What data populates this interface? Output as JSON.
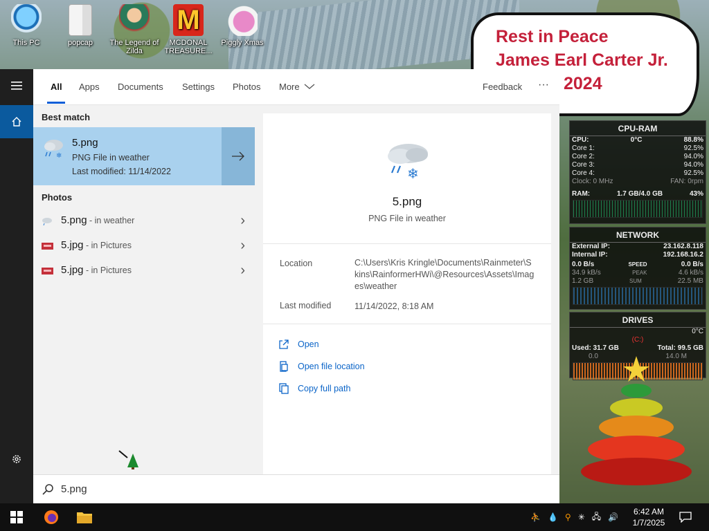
{
  "desktop": {
    "icons": [
      {
        "label": "This PC",
        "icon": "this-pc-icon"
      },
      {
        "label": "popcap",
        "icon": "popcap-icon"
      },
      {
        "label": "The Legend of Zilda",
        "icon": "zilda-game-icon"
      },
      {
        "label": "MCDONAL TREASURE...",
        "icon": "mcdonalds-icon"
      },
      {
        "label": "Piggly Xmas",
        "icon": "piggly-icon"
      }
    ],
    "rip_sign": {
      "line1": "Rest in Peace",
      "line2": "James Earl Carter Jr.",
      "line3": "2024"
    }
  },
  "widgets": {
    "cpu_ram": {
      "title": "CPU-RAM",
      "cpu_label": "CPU:",
      "cpu_temp": "0°C",
      "cpu_pct": "88.8%",
      "cores": [
        {
          "label": "Core 1:",
          "value": "92.5%"
        },
        {
          "label": "Core 2:",
          "value": "94.0%"
        },
        {
          "label": "Core 3:",
          "value": "94.0%"
        },
        {
          "label": "Core 4:",
          "value": "92.5%"
        }
      ],
      "clock": "Clock: 0 MHz",
      "fan": "FAN: 0rpm",
      "ram_label": "RAM:",
      "ram_value": "1.7 GB/4.0 GB",
      "ram_pct": "43%"
    },
    "network": {
      "title": "NETWORK",
      "ext_label": "External IP:",
      "ext_value": "23.162.8.118",
      "int_label": "Internal IP:",
      "int_value": "192.168.16.2",
      "rows": [
        {
          "l": "0.0 B/s",
          "m": "SPEED",
          "r": "0.0 B/s"
        },
        {
          "l": "34.9 kB/s",
          "m": "PEAK",
          "r": "4.6 kB/s"
        },
        {
          "l": "1.2 GB",
          "m": "SUM",
          "r": "22.5 MB"
        }
      ]
    },
    "drives": {
      "title": "DRIVES",
      "temp": "0°C",
      "drive": "(C:)",
      "used": "Used: 31.7 GB",
      "total": "Total: 99.5 GB",
      "read": "0.0",
      "write": "14.0 M"
    }
  },
  "search": {
    "tabs": [
      "All",
      "Apps",
      "Documents",
      "Settings",
      "Photos",
      "More"
    ],
    "feedback": "Feedback",
    "more_dots": "···",
    "best_match_header": "Best match",
    "best_match": {
      "name": "5.png",
      "type": "PNG File in weather",
      "modified": "Last modified: 11/14/2022"
    },
    "photos_header": "Photos",
    "photos": [
      {
        "name": "5.png",
        "loc": " - in weather"
      },
      {
        "name": "5.jpg",
        "loc": " - in Pictures"
      },
      {
        "name": "5.jpg",
        "loc": " - in Pictures"
      }
    ],
    "preview": {
      "title": "5.png",
      "subtitle": "PNG File in weather",
      "location_label": "Location",
      "location_value": "C:\\Users\\Kris Kringle\\Documents\\Rainmeter\\Skins\\RainformerHWi\\@Resources\\Assets\\Images\\weather",
      "modified_label": "Last modified",
      "modified_value": "11/14/2022, 8:18 AM",
      "actions": [
        "Open",
        "Open file location",
        "Copy full path"
      ]
    },
    "query": "5.png"
  },
  "taskbar": {
    "time": "6:42 AM",
    "date": "1/7/2025"
  }
}
